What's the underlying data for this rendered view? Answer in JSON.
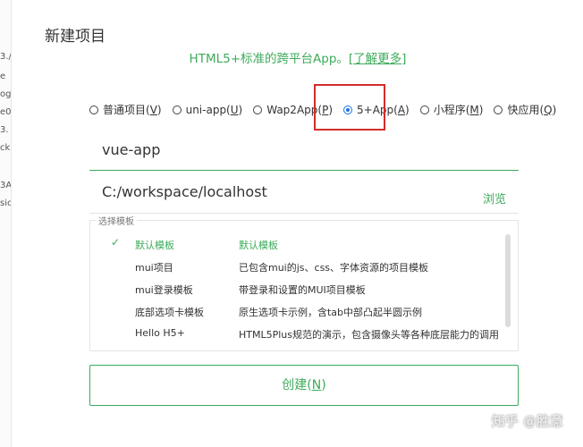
{
  "left_strip": [
    "3./",
    "e",
    "og",
    "e0",
    "3.",
    "ck",
    "3A",
    "sic"
  ],
  "dialog": {
    "title": "新建项目",
    "subtitle": {
      "text": "HTML5+标准的跨平台App。",
      "link": "[了解更多]"
    },
    "project_types": [
      {
        "label": "普通项目(",
        "key": "V",
        "close": ")",
        "selected": false
      },
      {
        "label": "uni-app(",
        "key": "U",
        "close": ")",
        "selected": false
      },
      {
        "label": "Wap2App(",
        "key": "P",
        "close": ")",
        "selected": false
      },
      {
        "label": "5+App(",
        "key": "A",
        "close": ")",
        "selected": true
      },
      {
        "label": "小程序(",
        "key": "M",
        "close": ")",
        "selected": false
      },
      {
        "label": "快应用(",
        "key": "Q",
        "close": ")",
        "selected": false
      }
    ],
    "project_name": "vue-app",
    "location": "C:/workspace/localhost",
    "browse_label": "浏览",
    "template_group_label": "选择模板",
    "selected_check": "✓",
    "templates": [
      {
        "name": "默认模板",
        "desc": "默认模板",
        "selected": true
      },
      {
        "name": "mui项目",
        "desc": "已包含mui的js、css、字体资源的项目模板",
        "selected": false
      },
      {
        "name": "mui登录模板",
        "desc": "带登录和设置的MUI项目模板",
        "selected": false
      },
      {
        "name": "底部选项卡模板",
        "desc": "原生选项卡示例，含tab中部凸起半圆示例",
        "selected": false
      },
      {
        "name": "Hello H5+",
        "desc": "HTML5Plus规范的演示，包含摄像头等各种底层能力的调用",
        "selected": false
      }
    ],
    "create_button": {
      "label": "创建(",
      "key": "N",
      "close": ")"
    }
  },
  "watermark": "知乎 @胜意",
  "colors": {
    "accent": "#3cab5a",
    "highlight": "#d42b2b",
    "radio_selected": "#1a73e8"
  }
}
